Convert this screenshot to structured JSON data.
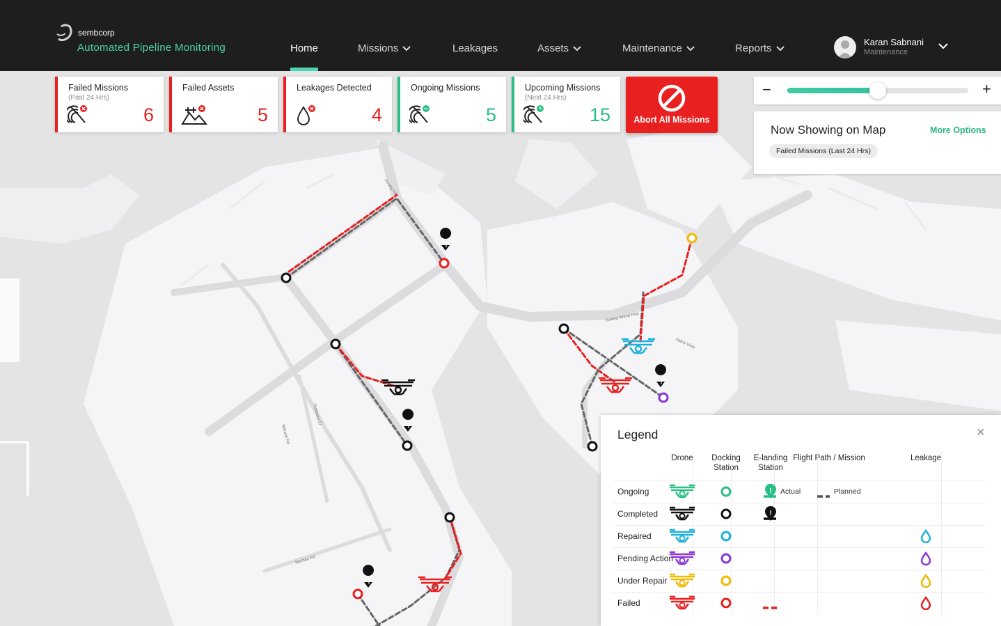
{
  "brand": {
    "company": "sembcorp",
    "app_title": "Automated Pipeline Monitoring"
  },
  "nav": [
    {
      "label": "Home",
      "active": true,
      "has_menu": false
    },
    {
      "label": "Missions",
      "active": false,
      "has_menu": true
    },
    {
      "label": "Leakages",
      "active": false,
      "has_menu": false
    },
    {
      "label": "Assets",
      "active": false,
      "has_menu": true
    },
    {
      "label": "Maintenance",
      "active": false,
      "has_menu": true
    },
    {
      "label": "Reports",
      "active": false,
      "has_menu": true
    }
  ],
  "user": {
    "name": "Karan Sabnani",
    "role": "Maintenance"
  },
  "stats": [
    {
      "title": "Failed Missions",
      "subtitle": "(Past 24 Hrs)",
      "value": "6",
      "color": "#e8201f",
      "icon": "failed-mission-icon"
    },
    {
      "title": "Failed Assets",
      "subtitle": "",
      "value": "5",
      "color": "#e8201f",
      "icon": "failed-asset-icon"
    },
    {
      "title": "Leakages Detected",
      "subtitle": "",
      "value": "4",
      "color": "#e8201f",
      "icon": "leakage-icon"
    },
    {
      "title": "Ongoing Missions",
      "subtitle": "",
      "value": "5",
      "color": "#2bbf84",
      "icon": "ongoing-mission-icon"
    },
    {
      "title": "Upcoming Missions",
      "subtitle": "(Next 24 Hrs)",
      "value": "15",
      "color": "#2bbf84",
      "icon": "upcoming-mission-icon"
    }
  ],
  "abort_button": {
    "label": "Abort All Missions"
  },
  "zoom": {
    "level": 0.5
  },
  "now_showing": {
    "title": "Now Showing on Map",
    "more_options": "More Options",
    "filter": "Failed Missions (Last 24 Hrs)"
  },
  "legend": {
    "title": "Legend",
    "columns": [
      "Drone",
      "Docking\nStation",
      "E-landing\nStation",
      "Flight Path / Mission",
      "Leakage"
    ],
    "rows": [
      {
        "label": "Ongoing",
        "color": "#2bbf84"
      },
      {
        "label": "Completed",
        "color": "#111111"
      },
      {
        "label": "Repaired",
        "color": "#1fb1dc"
      },
      {
        "label": "Pending Action",
        "color": "#8a35d6"
      },
      {
        "label": "Under Repair",
        "color": "#efb900"
      },
      {
        "label": "Failed",
        "color": "#e8201f"
      }
    ],
    "path_actual": "Actual",
    "path_planned": "Planned"
  },
  "map_labels": [
    "Jurong Island Hwy",
    "Jurong Hill",
    "Sakra View",
    "Tembusu Cr",
    "Meranti Rd",
    "Merbau Rd"
  ]
}
